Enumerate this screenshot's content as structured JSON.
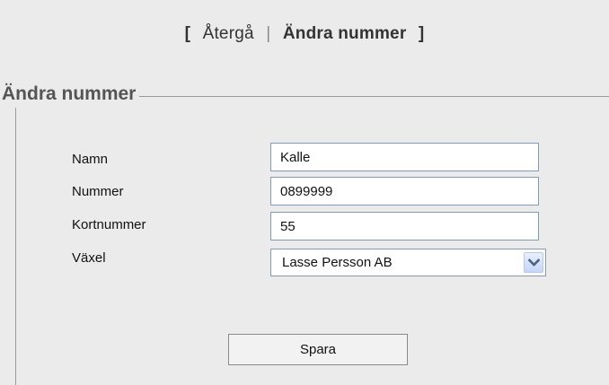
{
  "breadcrumb": {
    "open_bracket": "[",
    "back_label": "Återgå",
    "separator": "|",
    "current_label": "Ändra nummer",
    "close_bracket": "]"
  },
  "form": {
    "legend": "Ändra nummer",
    "fields": {
      "name": {
        "label": "Namn",
        "value": "Kalle"
      },
      "number": {
        "label": "Nummer",
        "value": "0899999"
      },
      "short_number": {
        "label": "Kortnummer",
        "value": "55"
      },
      "switchboard": {
        "label": "Växel",
        "selected": "Lasse Persson AB",
        "icon": "chevron-down-icon"
      }
    },
    "save_label": "Spara"
  },
  "colors": {
    "panel_background": "#ebebeb",
    "input_border": "#7f9db9",
    "dropdown_button": "#c6d5f7",
    "dropdown_arrow": "#4d6185"
  }
}
